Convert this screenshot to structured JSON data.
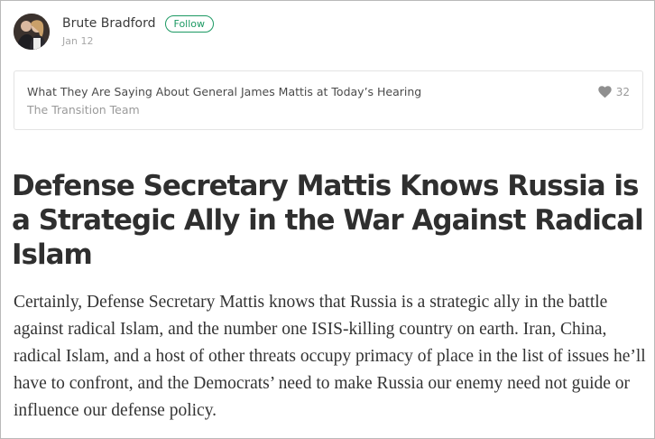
{
  "author": {
    "name": "Brute Bradford",
    "follow_label": "Follow",
    "date": "Jan 12"
  },
  "response_card": {
    "title": "What They Are Saying About General James Mattis at Today’s Hearing",
    "subtitle": "The Transition Team",
    "likes": "32"
  },
  "article": {
    "headline": "Defense Secretary Mattis Knows Russia is a Strategic Ally in the War Against Radical Islam",
    "body": "Certainly, Defense Secretary Mattis knows that Russia is a strategic ally in the battle against radical Islam, and the number one ISIS-killing country on earth. Iran, China, radical Islam, and a host of other threats occupy primacy of place in the list of issues he’ll have to confront, and the Democrats’ need to make Russia our enemy need not guide or influence our defense policy."
  },
  "colors": {
    "accent": "#1c9963",
    "muted": "#9a9a9a",
    "text": "#333333"
  },
  "icons": {
    "avatar": "user-avatar",
    "like": "heart-icon"
  }
}
